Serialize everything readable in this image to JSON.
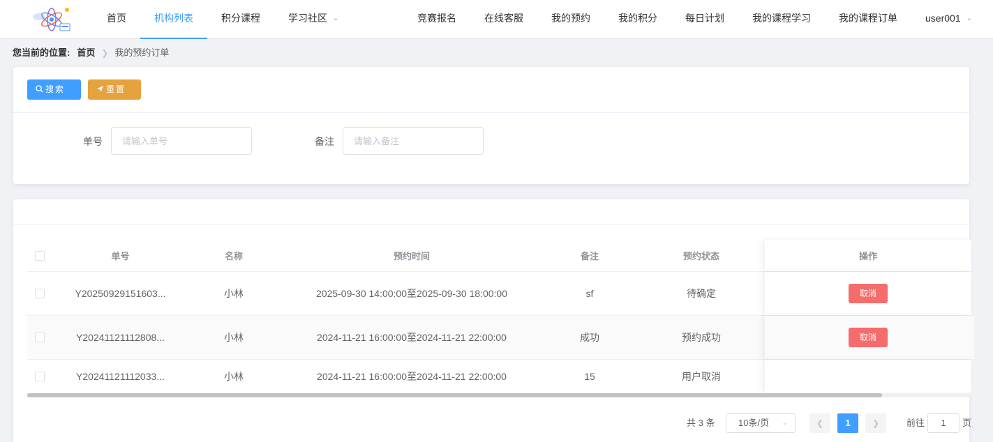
{
  "nav": {
    "left": [
      {
        "label": "首页",
        "active": false
      },
      {
        "label": "机构列表",
        "active": true
      },
      {
        "label": "积分课程",
        "active": false
      },
      {
        "label": "学习社区",
        "active": false,
        "dropdown": true
      }
    ],
    "right": [
      {
        "label": "竞赛报名"
      },
      {
        "label": "在线客服"
      },
      {
        "label": "我的预约"
      },
      {
        "label": "我的积分"
      },
      {
        "label": "每日计划"
      },
      {
        "label": "我的课程学习"
      },
      {
        "label": "我的课程订单"
      },
      {
        "label": "user001",
        "dropdown": true
      }
    ],
    "accent_color": "#409eff"
  },
  "breadcrumb": {
    "label": "您当前的位置:",
    "home": "首页",
    "current": "我的预约订单"
  },
  "search": {
    "search_label": "搜索",
    "reset_label": "重置",
    "order_no_label": "单号",
    "order_no_placeholder": "请输入单号",
    "remark_label": "备注",
    "remark_placeholder": "请输入备注"
  },
  "table": {
    "headers": {
      "order_no": "单号",
      "name": "名称",
      "time": "预约时间",
      "remark": "备注",
      "status": "预约状态",
      "operation": "操作"
    },
    "rows": [
      {
        "order_no": "Y20250929151603...",
        "name": "小林",
        "time": "2025-09-30 14:00:00至2025-09-30 18:00:00",
        "remark": "sf",
        "status": "待确定",
        "action": "取消"
      },
      {
        "order_no": "Y20241121112808...",
        "name": "小林",
        "time": "2024-11-21 16:00:00至2024-11-21 22:00:00",
        "remark": "成功",
        "status": "预约成功",
        "action": "取消"
      },
      {
        "order_no": "Y20241121112033...",
        "name": "小林",
        "time": "2024-11-21 16:00:00至2024-11-21 22:00:00",
        "remark": "15",
        "status": "用户取消",
        "action": ""
      }
    ]
  },
  "pagination": {
    "total": "共 3 条",
    "page_size": "10条/页",
    "current_page": "1",
    "goto_label": "前往",
    "goto_value": "1",
    "goto_unit": "页"
  },
  "colors": {
    "primary": "#409eff",
    "warning": "#e6a23c",
    "danger": "#f56c6c"
  }
}
